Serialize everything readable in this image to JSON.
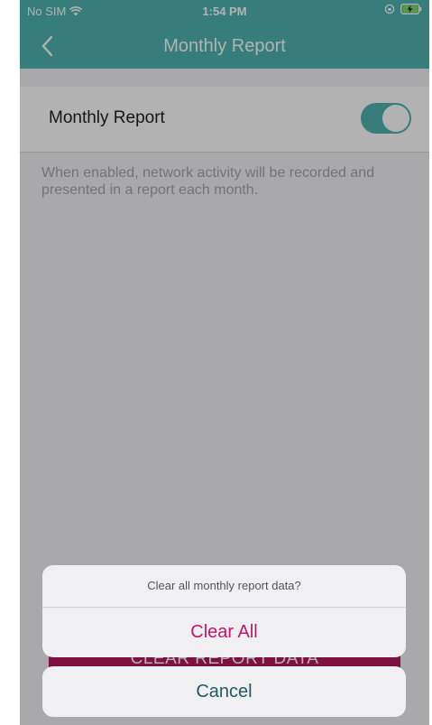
{
  "status": {
    "carrier": "No SIM",
    "time": "1:54 PM"
  },
  "nav": {
    "title": "Monthly Report"
  },
  "settings": {
    "toggle_label": "Monthly Report",
    "toggle_on": true,
    "description": "When enabled, network activity will be recorded and presented in a report each month."
  },
  "background_button": {
    "label": "CLEAR REPORT DATA"
  },
  "action_sheet": {
    "title": "Clear all monthly report data?",
    "confirm_label": "Clear All",
    "cancel_label": "Cancel"
  },
  "colors": {
    "accent": "#4fb3b1",
    "destructive": "#c0186a",
    "button_bg": "#b4195f"
  }
}
